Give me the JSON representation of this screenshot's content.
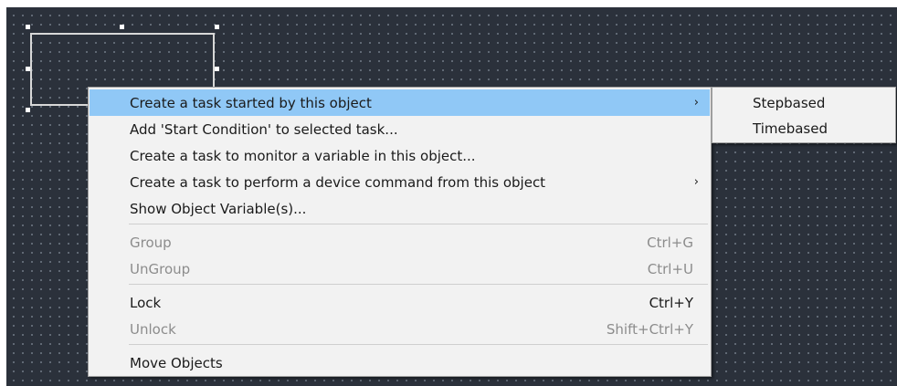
{
  "context_menu": {
    "items": [
      {
        "label": "Create a  task started by this object",
        "shortcut": "",
        "submenu": true,
        "highlighted": true,
        "enabled": true
      },
      {
        "label": "Add 'Start Condition' to selected task...",
        "shortcut": "",
        "submenu": false,
        "enabled": true
      },
      {
        "label": "Create a task to monitor a variable in this object...",
        "shortcut": "",
        "submenu": false,
        "enabled": true
      },
      {
        "label": "Create a task to perform a device command from this object",
        "shortcut": "",
        "submenu": true,
        "enabled": true
      },
      {
        "label": "Show Object Variable(s)...",
        "shortcut": "",
        "submenu": false,
        "enabled": true
      },
      {
        "label": "Group",
        "shortcut": "Ctrl+G",
        "enabled": false
      },
      {
        "label": "UnGroup",
        "shortcut": "Ctrl+U",
        "enabled": false
      },
      {
        "label": "Lock",
        "shortcut": "Ctrl+Y",
        "enabled": true
      },
      {
        "label": "Unlock",
        "shortcut": "Shift+Ctrl+Y",
        "enabled": false
      },
      {
        "label": "Move Objects",
        "shortcut": "",
        "enabled": true
      }
    ],
    "submenu_arrow": "›"
  },
  "submenu": {
    "items": [
      {
        "label": "Stepbased"
      },
      {
        "label": "Timebased"
      }
    ]
  },
  "colors": {
    "canvas_bg": "#2b313b",
    "highlight": "#90c8f6",
    "menu_bg": "#f2f2f2",
    "disabled_text": "#8c8c8c"
  }
}
